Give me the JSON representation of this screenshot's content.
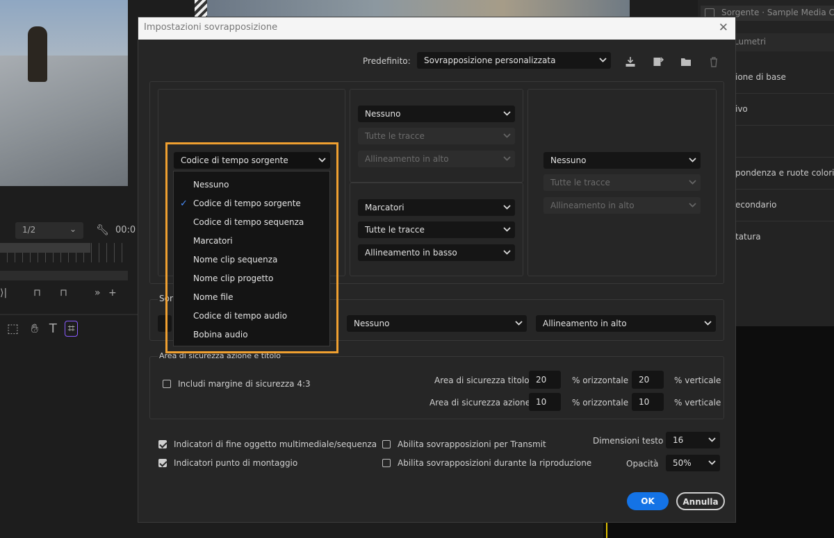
{
  "background": {
    "source_tab": "Sorgente · Sample Media Clip",
    "lumetri_tab": "Lumetri",
    "panel_items": [
      "ione di base",
      "ivo",
      "pondenza e ruote colori",
      "econdario",
      "tatura"
    ],
    "zoom": "1/2",
    "timecode": "00:0"
  },
  "dialog": {
    "title": "Impostazioni sovrapposizione",
    "preset_label": "Predefinito:",
    "preset_value": "Sovrapposizione personalizzata",
    "left_select": "Codice di tempo sorgente",
    "top_center": {
      "s1": "Nessuno",
      "s2": "Tutte le tracce",
      "s3": "Allineamento in alto"
    },
    "bottom_center": {
      "s1": "Marcatori",
      "s2": "Tutte le tracce",
      "s3": "Allineamento in basso"
    },
    "right": {
      "s1": "Nessuno",
      "s2": "Tutte le tracce",
      "s3": "Allineamento in alto"
    },
    "source_section_label": "Sorg",
    "source_row": {
      "s1": "Nessuno",
      "s2": "Allineamento in alto"
    },
    "safety": {
      "title": "Area di sicurezza azione e titolo",
      "margin_43": "Includi margine di sicurezza 4:3",
      "title_label": "Area di sicurezza titolo",
      "title_h": "20",
      "title_v": "20",
      "action_label": "Area di sicurezza azione",
      "action_h": "10",
      "action_v": "10",
      "pct_h": "% orizzontale",
      "pct_v": "% verticale"
    },
    "options": {
      "end_indicators": "Indicatori di fine oggetto multimediale/sequenza",
      "edit_indicators": "Indicatori punto di montaggio",
      "transmit": "Abilita sovrapposizioni per Transmit",
      "playback": "Abilita sovrapposizioni durante la riproduzione",
      "text_size_label": "Dimensioni testo",
      "text_size": "16",
      "opacity_label": "Opacità",
      "opacity": "50%"
    },
    "ok": "OK",
    "cancel": "Annulla"
  },
  "menu": {
    "items": [
      "Nessuno",
      "Codice di tempo sorgente",
      "Codice di tempo sequenza",
      "Marcatori",
      "Nome clip sequenza",
      "Nome clip progetto",
      "Nome file",
      "Codice di tempo audio",
      "Bobina audio"
    ],
    "selected_index": 1
  },
  "colors": {
    "accent": "#1473e6",
    "highlight": "#f0a030",
    "check": "#4a90ff"
  }
}
